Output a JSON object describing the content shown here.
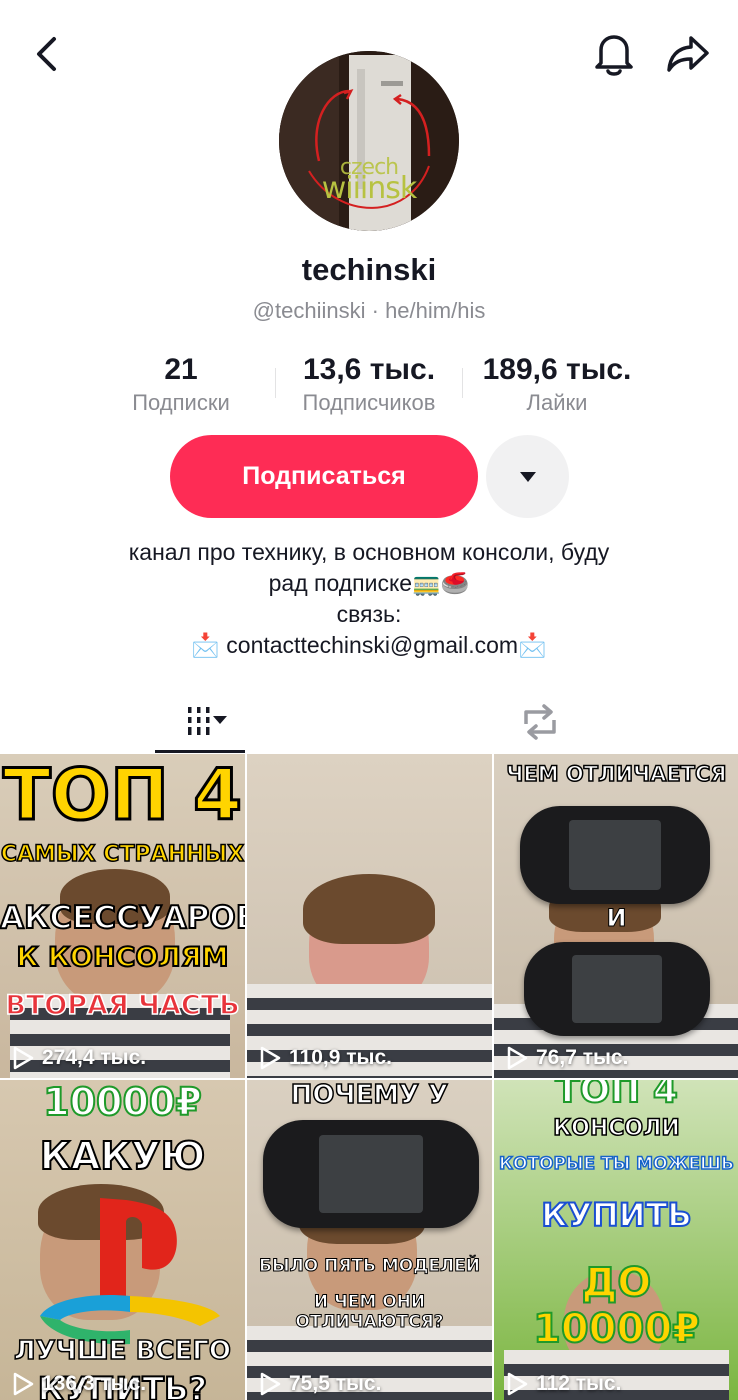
{
  "profile": {
    "display_name": "techinski",
    "handle": "@techiinski",
    "pronouns": "he/him/his",
    "handle_separator": "·",
    "avatar_text_1": "czech",
    "avatar_text_2": "wiiinsk"
  },
  "stats": [
    {
      "value": "21",
      "label": "Подписки"
    },
    {
      "value": "13,6 тыс.",
      "label": "Подписчиков"
    },
    {
      "value": "189,6 тыс.",
      "label": "Лайки"
    }
  ],
  "actions": {
    "follow_label": "Подписаться",
    "follow_color": "#fe2c55"
  },
  "bio": {
    "line1": "канал про технику, в основном консоли, буду",
    "line2": "рад подписке🚃🥌",
    "line3": "связь:",
    "line4": "📩 contacttechinski@gmail.com📩"
  },
  "tabs": [
    {
      "name": "videos",
      "icon": "grid-bars-icon",
      "active": true
    },
    {
      "name": "reposts",
      "icon": "repost-icon",
      "active": false
    }
  ],
  "videos": [
    {
      "views": "274,4 тыс.",
      "captions": [
        "ТОП 4",
        "САМЫХ СТРАННЫХ",
        "АКСЕССУАРОВ",
        "К КОНСОЛЯМ",
        "ВТОРАЯ ЧАСТЬ"
      ]
    },
    {
      "views": "110,9 тыс.",
      "captions": []
    },
    {
      "views": "76,7 тыс.",
      "captions": [
        "ЧЕМ ОТЛИЧАЕТСЯ",
        "И"
      ]
    },
    {
      "views": "136,3 тыс.",
      "captions": [
        "10000₽",
        "КАКУЮ",
        "ЛУЧШЕ ВСЕГО",
        "КУПИТЬ?"
      ]
    },
    {
      "views": "75,5 тыс.",
      "captions": [
        "ПОЧЕМУ У",
        "БЫЛО ПЯТЬ МОДЕЛЕЙ",
        "И ЧЕМ ОНИ ОТЛИЧАЮТСЯ?"
      ]
    },
    {
      "views": "112 тыс.",
      "captions": [
        "ТОП 4",
        "КОНСОЛИ",
        "КОТОРЫЕ ТЫ МОЖЕШЬ",
        "КУПИТЬ",
        "ДО 10000₽"
      ]
    }
  ]
}
